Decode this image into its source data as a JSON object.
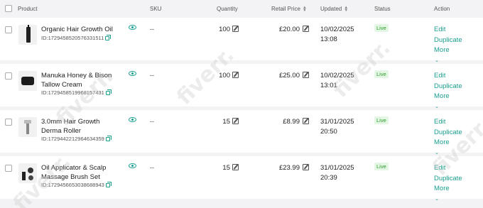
{
  "header": {
    "product": "Product",
    "sku": "SKU",
    "quantity": "Quantity",
    "retail_price": "Retail Price",
    "updated": "Updated",
    "status": "Status",
    "action": "Action"
  },
  "rows": [
    {
      "name": "Organic Hair Growth Oil",
      "id": "ID:1729458520576331511",
      "sku": "--",
      "quantity": "100",
      "price": "£20.00",
      "updated_date": "10/02/2025",
      "updated_time": "13:08",
      "status": "Live",
      "actions": {
        "edit": "Edit",
        "duplicate": "Duplicate",
        "more": "More"
      }
    },
    {
      "name": "Manuka Honey & Bison Tallow Cream",
      "id": "ID:1729458519968157431",
      "sku": "--",
      "quantity": "100",
      "price": "£25.00",
      "updated_date": "10/02/2025",
      "updated_time": "13:01",
      "status": "Live",
      "actions": {
        "edit": "Edit",
        "duplicate": "Duplicate",
        "more": "More"
      }
    },
    {
      "name": "3.0mm Hair Growth Derma Roller",
      "id": "ID:1729442212964634359",
      "sku": "--",
      "quantity": "15",
      "price": "£8.99",
      "updated_date": "31/01/2025",
      "updated_time": "20:50",
      "status": "Live",
      "actions": {
        "edit": "Edit",
        "duplicate": "Duplicate",
        "more": "More"
      }
    },
    {
      "name": "Oil Applicator & Scalp Massage Brush Set",
      "id": "ID:1729456653038688943",
      "sku": "--",
      "quantity": "15",
      "price": "£23.99",
      "updated_date": "31/01/2025",
      "updated_time": "20:39",
      "status": "Live",
      "actions": {
        "edit": "Edit",
        "duplicate": "Duplicate",
        "more": "More"
      }
    }
  ],
  "watermark": "fiverr.",
  "icons": {
    "view": "eye-icon",
    "copy": "copy-icon",
    "edit": "pencil-square-icon",
    "sort": "sort-arrows-icon",
    "more": "chevron-down-icon"
  },
  "colors": {
    "accent": "#1a9e8f",
    "live": "#2e9e2e",
    "live_bg": "#e4f6e4"
  }
}
